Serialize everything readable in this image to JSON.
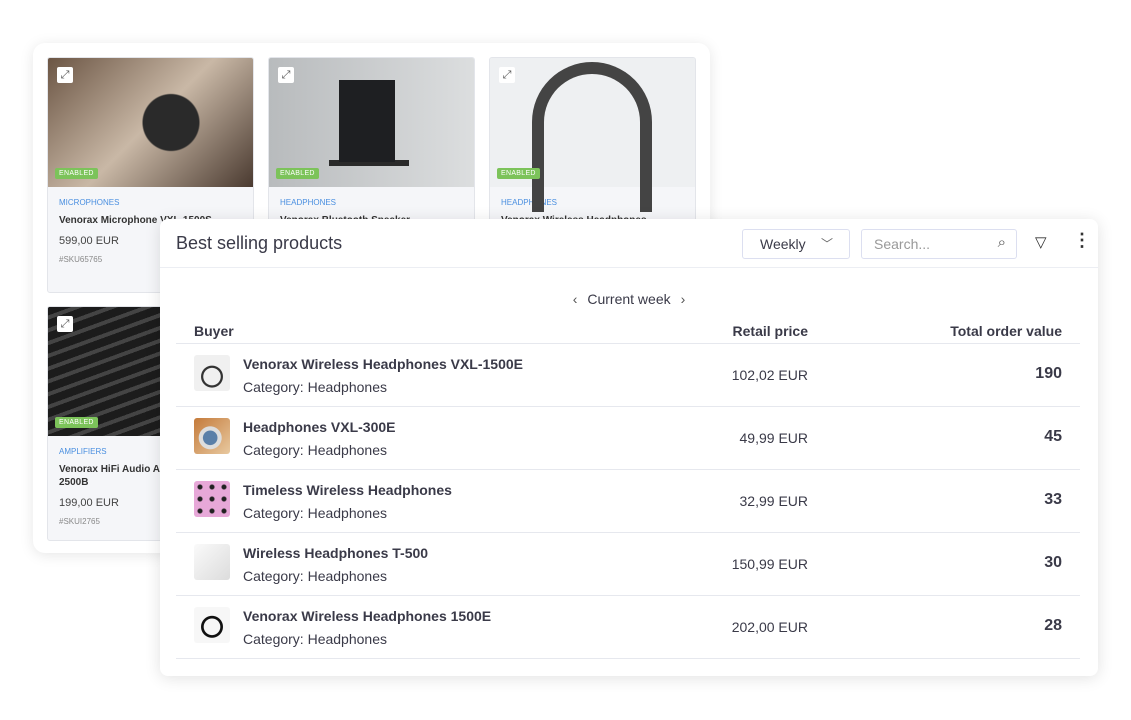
{
  "catalog": {
    "cards": [
      {
        "category": "MICROPHONES",
        "name": "Venorax Microphone VXL-1500S",
        "price": "599,00 EUR",
        "sku": "#SKU65765",
        "badge": "ENABLED"
      },
      {
        "category": "HEADPHONES",
        "name": "Venorax Bluetooth Speaker",
        "badge": "ENABLED"
      },
      {
        "category": "HEADPHONES",
        "name": "Venorax Wireless Headphones",
        "badge": "ENABLED"
      },
      {
        "category": "AMPLIFIERS",
        "name": "Venorax HiFi Audio Amplifier VXL-2500B",
        "price": "199,00 EUR",
        "sku": "#SKUI2765",
        "badge": "ENABLED"
      }
    ]
  },
  "panel": {
    "title": "Best selling products",
    "period_select": "Weekly",
    "search_placeholder": "Search...",
    "period_label": "Current week",
    "columns": {
      "buyer": "Buyer",
      "price": "Retail price",
      "total": "Total order value"
    },
    "rows": [
      {
        "name": "Venorax Wireless Headphones VXL-1500E",
        "category": "Category: Headphones",
        "price": "102,02 EUR",
        "total": "190"
      },
      {
        "name": "Headphones VXL-300E",
        "category": "Category: Headphones",
        "price": "49,99 EUR",
        "total": "45"
      },
      {
        "name": "Timeless Wireless Headphones",
        "category": "Category: Headphones",
        "price": "32,99 EUR",
        "total": "33"
      },
      {
        "name": "Wireless Headphones T-500",
        "category": "Category: Headphones",
        "price": "150,99 EUR",
        "total": "30"
      },
      {
        "name": "Venorax Wireless Headphones 1500E",
        "category": "Category: Headphones",
        "price": "202,00 EUR",
        "total": "28"
      }
    ]
  }
}
